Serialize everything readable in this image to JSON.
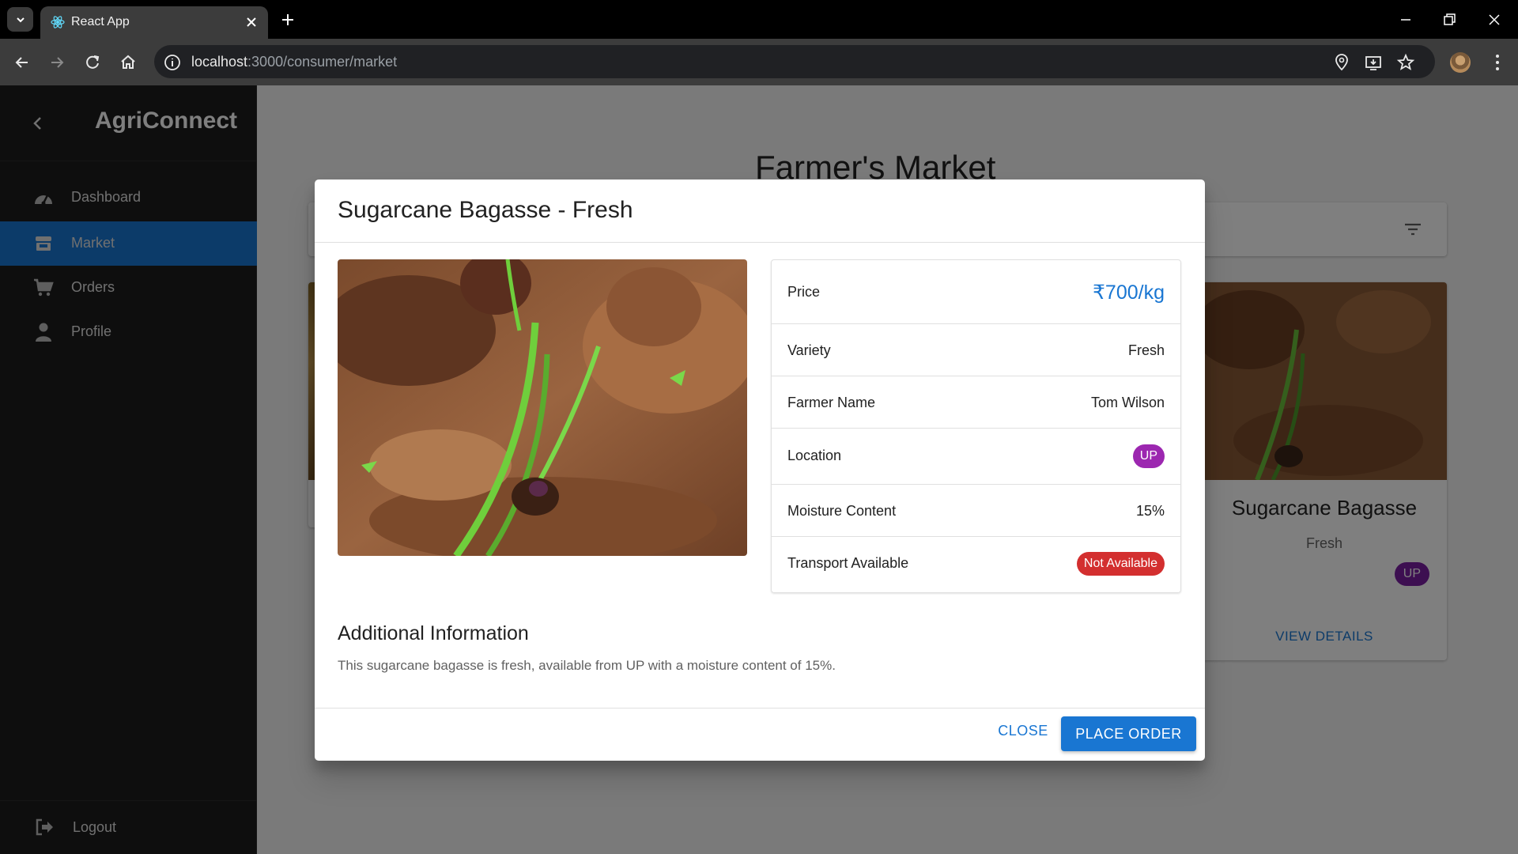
{
  "browser": {
    "tab_title": "React App",
    "url_host": "localhost",
    "url_path": ":3000/consumer/market"
  },
  "sidebar": {
    "brand": "AgriConnect",
    "items": [
      {
        "label": "Dashboard",
        "icon": "dashboard-icon",
        "active": false
      },
      {
        "label": "Market",
        "icon": "store-icon",
        "active": true
      },
      {
        "label": "Orders",
        "icon": "cart-icon",
        "active": false
      },
      {
        "label": "Profile",
        "icon": "person-icon",
        "active": false
      }
    ],
    "logout_label": "Logout"
  },
  "main": {
    "title": "Farmer's Market",
    "cards": [
      {
        "title": "Sugarcane Bagasse",
        "subtitle": "Fresh",
        "location": "UP",
        "link": "VIEW DETAILS"
      }
    ]
  },
  "modal": {
    "title": "Sugarcane Bagasse - Fresh",
    "details": {
      "price_label": "Price",
      "price_value": "₹700/kg",
      "variety_label": "Variety",
      "variety_value": "Fresh",
      "farmer_label": "Farmer Name",
      "farmer_value": "Tom Wilson",
      "location_label": "Location",
      "location_value": "UP",
      "moisture_label": "Moisture Content",
      "moisture_value": "15%",
      "transport_label": "Transport Available",
      "transport_value": "Not Available"
    },
    "additional_heading": "Additional Information",
    "additional_text": "This sugarcane bagasse is fresh, available from UP with a moisture content of 15%.",
    "close_label": "CLOSE",
    "order_label": "PLACE ORDER"
  },
  "colors": {
    "primary": "#1976d2",
    "location_chip": "#9c27b0",
    "not_available_chip": "#d32f2f",
    "sidebar_bg": "#1c1c1c"
  }
}
